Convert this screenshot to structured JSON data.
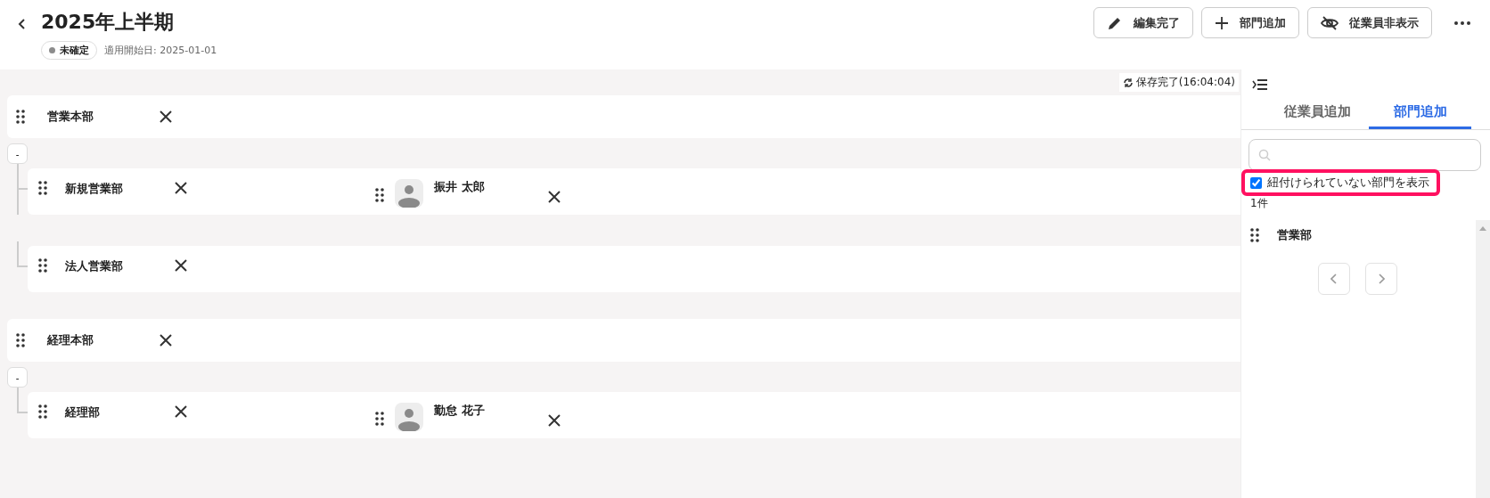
{
  "header": {
    "title": "2025年上半期",
    "status_badge": {
      "label": "未確定",
      "color": "#8c8c8c"
    },
    "effective_date": "適用開始日: 2025-01-01"
  },
  "actions": [
    {
      "kind": "edit",
      "label": "編集完了"
    },
    {
      "kind": "add",
      "label": "部門追加"
    },
    {
      "kind": "hide",
      "label": "従業員非表示"
    }
  ],
  "main": {
    "save_status": "保存完了(16:04:04)",
    "departments": [
      {
        "name": "営業本部",
        "toggle": "-",
        "children": [
          {
            "name": "新規営業部",
            "employees": [
              {
                "name": "振井 太郎"
              }
            ]
          },
          {
            "name": "法人営業部"
          }
        ]
      },
      {
        "name": "経理本部",
        "toggle": "-",
        "children": [
          {
            "name": "経理部",
            "employees": [
              {
                "name": "勤怠 花子"
              }
            ]
          }
        ]
      }
    ]
  },
  "side_panel": {
    "tabs": [
      {
        "label": "従業員追加",
        "selected": false
      },
      {
        "label": "部門追加",
        "selected": true
      }
    ],
    "filter": {
      "label": "紐付けられていない部門を表示",
      "checked": true,
      "highlighted": true
    },
    "count": "1件",
    "items": [
      {
        "name": "営業部"
      }
    ]
  }
}
